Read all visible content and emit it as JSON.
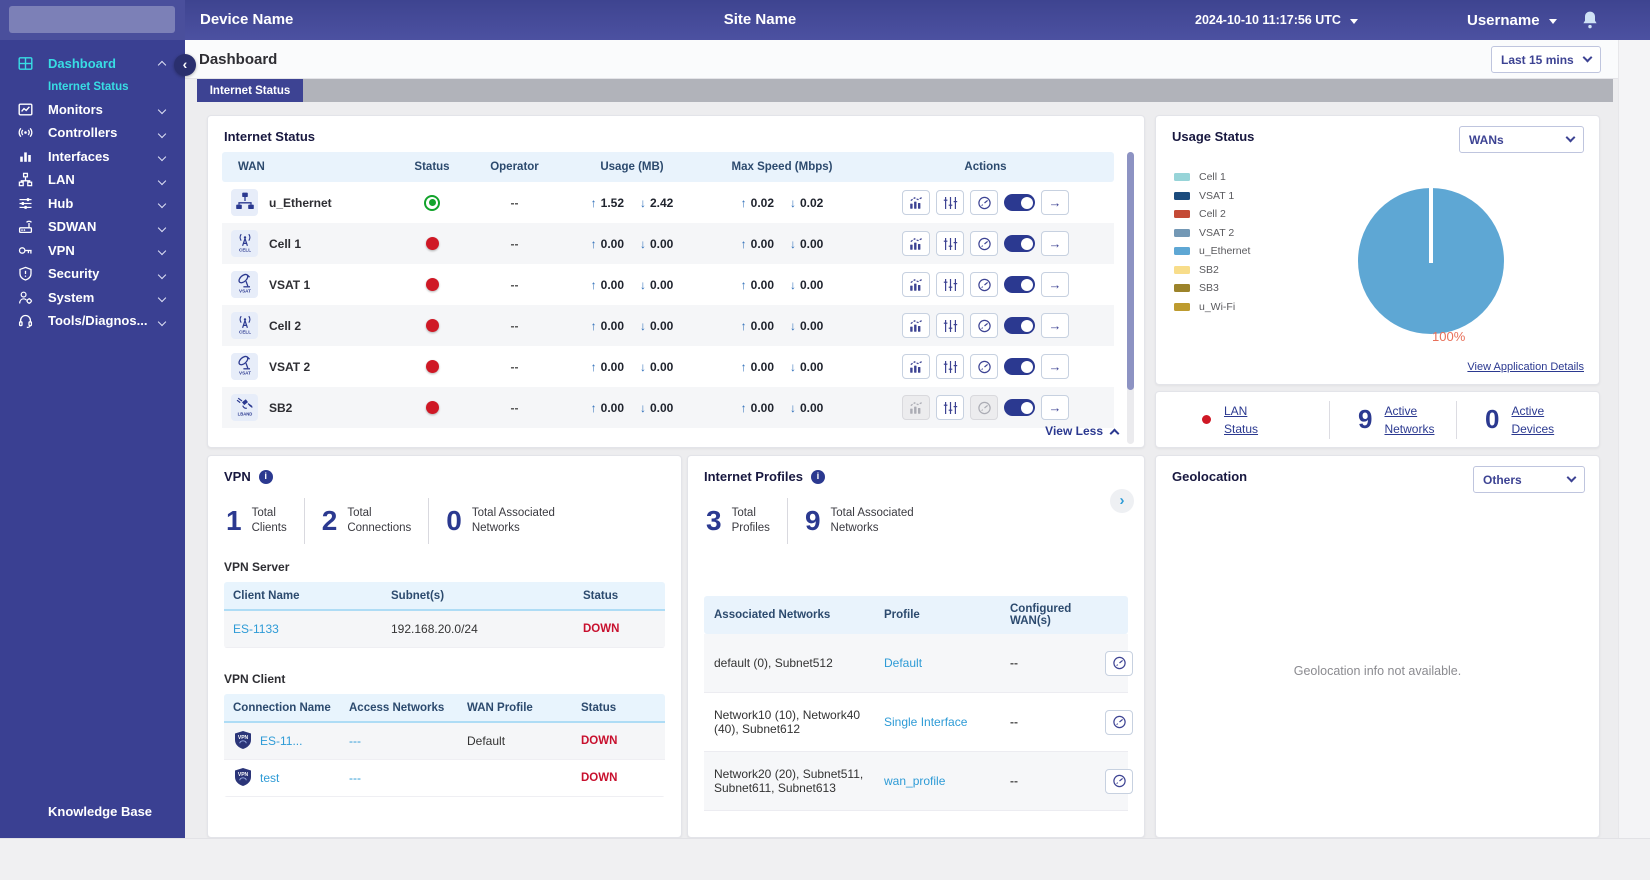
{
  "topbar": {
    "device_name": "Device Name",
    "site_name": "Site Name",
    "timestamp": "2024-10-10 11:17:56 UTC",
    "username": "Username"
  },
  "sidebar": {
    "items": [
      {
        "label": "Dashboard",
        "icon": "dashboard-icon",
        "type": "main",
        "state": "active",
        "chevron": "up"
      },
      {
        "label": "Internet Status",
        "type": "sub",
        "state": "active",
        "chevron": ""
      },
      {
        "label": "Monitors",
        "icon": "monitors-icon",
        "type": "main",
        "state": "",
        "chevron": "down"
      },
      {
        "label": "Controllers",
        "icon": "controllers-icon",
        "type": "main",
        "state": "",
        "chevron": "down"
      },
      {
        "label": "Interfaces",
        "icon": "interfaces-icon",
        "type": "main",
        "state": "",
        "chevron": "down"
      },
      {
        "label": "LAN",
        "icon": "lan-icon",
        "type": "main",
        "state": "",
        "chevron": "down"
      },
      {
        "label": "Hub",
        "icon": "hub-icon",
        "type": "main",
        "state": "",
        "chevron": "down"
      },
      {
        "label": "SDWAN",
        "icon": "sdwan-icon",
        "type": "main",
        "state": "",
        "chevron": "down"
      },
      {
        "label": "VPN",
        "icon": "vpn-key-icon",
        "type": "main",
        "state": "",
        "chevron": "down"
      },
      {
        "label": "Security",
        "icon": "security-icon",
        "type": "main",
        "state": "",
        "chevron": "down"
      },
      {
        "label": "System",
        "icon": "system-icon",
        "type": "main",
        "state": "",
        "chevron": "down"
      },
      {
        "label": "Tools/Diagnos...",
        "icon": "tools-icon",
        "type": "main",
        "state": "",
        "chevron": "down"
      }
    ],
    "footer_label": "Knowledge Base"
  },
  "page": {
    "title": "Dashboard",
    "time_range": "Last 15 mins",
    "active_tab": "Internet Status"
  },
  "internet_status": {
    "title": "Internet Status",
    "columns": [
      "WAN",
      "Status",
      "Operator",
      "Usage (MB)",
      "Max Speed (Mbps)",
      "Actions"
    ],
    "rows": [
      {
        "wan": "u_Ethernet",
        "icon": "ethernet-icon",
        "status": "up",
        "operator": "--",
        "usage_up": "1.52",
        "usage_down": "2.42",
        "speed_up": "0.02",
        "speed_down": "0.02",
        "actions": "enabled"
      },
      {
        "wan": "Cell 1",
        "icon": "cell-icon",
        "status": "down",
        "operator": "--",
        "usage_up": "0.00",
        "usage_down": "0.00",
        "speed_up": "0.00",
        "speed_down": "0.00",
        "actions": "enabled"
      },
      {
        "wan": "VSAT 1",
        "icon": "vsat-icon",
        "status": "down",
        "operator": "--",
        "usage_up": "0.00",
        "usage_down": "0.00",
        "speed_up": "0.00",
        "speed_down": "0.00",
        "actions": "enabled"
      },
      {
        "wan": "Cell 2",
        "icon": "cell-icon",
        "status": "down",
        "operator": "--",
        "usage_up": "0.00",
        "usage_down": "0.00",
        "speed_up": "0.00",
        "speed_down": "0.00",
        "actions": "enabled"
      },
      {
        "wan": "VSAT 2",
        "icon": "vsat-icon",
        "status": "down",
        "operator": "--",
        "usage_up": "0.00",
        "usage_down": "0.00",
        "speed_up": "0.00",
        "speed_down": "0.00",
        "actions": "enabled"
      },
      {
        "wan": "SB2",
        "icon": "lband-icon",
        "status": "down",
        "operator": "--",
        "usage_up": "0.00",
        "usage_down": "0.00",
        "speed_up": "0.00",
        "speed_down": "0.00",
        "actions": "disabled"
      }
    ],
    "view_less_label": "View Less"
  },
  "usage_status": {
    "title": "Usage Status",
    "filter": "WANs",
    "details_link": "View Application Details",
    "chart_data": {
      "type": "pie",
      "series": [
        {
          "label": "Cell 1",
          "value": 0,
          "color": "#97d4d8"
        },
        {
          "label": "VSAT 1",
          "value": 0,
          "color": "#1b4b7d"
        },
        {
          "label": "Cell 2",
          "value": 0,
          "color": "#c44a36"
        },
        {
          "label": "VSAT 2",
          "value": 0,
          "color": "#7398b5"
        },
        {
          "label": "u_Ethernet",
          "value": 100,
          "color": "#5ea7d4"
        },
        {
          "label": "SB2",
          "value": 0,
          "color": "#f8dd8a"
        },
        {
          "label": "SB3",
          "value": 0,
          "color": "#9c832a"
        },
        {
          "label": "u_Wi-Fi",
          "value": 0,
          "color": "#bd9b2f"
        }
      ],
      "annotation": "100%",
      "legend_position": "left"
    }
  },
  "lan_summary": {
    "status_label": "LAN\nStatus",
    "stats": [
      {
        "value": "9",
        "label": "Active\nNetworks"
      },
      {
        "value": "0",
        "label": "Active\nDevices"
      }
    ]
  },
  "vpn": {
    "title": "VPN",
    "stats": [
      {
        "value": "1",
        "label": "Total\nClients"
      },
      {
        "value": "2",
        "label": "Total\nConnections"
      },
      {
        "value": "0",
        "label": "Total Associated\nNetworks"
      }
    ],
    "server": {
      "title": "VPN Server",
      "columns": [
        "Client Name",
        "Subnet(s)",
        "Status"
      ],
      "rows": [
        {
          "client_name": "ES-1133",
          "subnets": "192.168.20.0/24",
          "status": "DOWN"
        }
      ]
    },
    "client": {
      "title": "VPN Client",
      "columns": [
        "Connection Name",
        "Access Networks",
        "WAN Profile",
        "Status"
      ],
      "rows": [
        {
          "name": "ES-11...",
          "icon": "vpn-shield-icon",
          "access": "---",
          "wan_profile": "Default",
          "status": "DOWN"
        },
        {
          "name": "test",
          "icon": "vpn-shield-icon",
          "access": "---",
          "wan_profile": "",
          "status": "DOWN"
        }
      ]
    }
  },
  "internet_profiles": {
    "title": "Internet Profiles",
    "stats": [
      {
        "value": "3",
        "label": "Total\nProfiles"
      },
      {
        "value": "9",
        "label": "Total Associated\nNetworks"
      }
    ],
    "columns": [
      "Associated Networks",
      "Profile",
      "Configured WAN(s)"
    ],
    "rows": [
      {
        "networks": "default (0), Subnet512",
        "profile": "Default",
        "wans": "--"
      },
      {
        "networks": "Network10 (10), Network40 (40), Subnet612",
        "profile": "Single Interface",
        "wans": "--"
      },
      {
        "networks": "Network20 (20), Subnet511, Subnet611, Subnet613",
        "profile": "wan_profile",
        "wans": "--"
      }
    ]
  },
  "geolocation": {
    "title": "Geolocation",
    "filter": "Others",
    "message": "Geolocation info not available."
  },
  "colors": {
    "accent": "#3d4393",
    "sidebar": "#3a4092",
    "active_cyan": "#38dde4",
    "link": "#2e9bd6",
    "down_red": "#c8102e",
    "status_green": "#12a32b",
    "pie_label": "#e8705a"
  }
}
